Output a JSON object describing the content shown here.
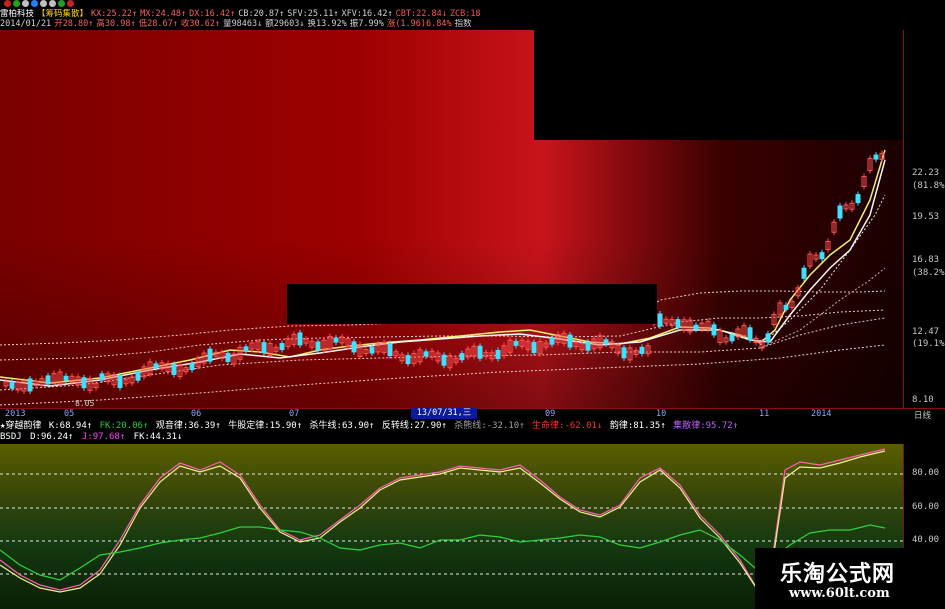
{
  "header": {
    "line1": [
      {
        "text": "雷柏科技",
        "color": "#ffffff"
      },
      {
        "text": "【筹码集散】",
        "color": "#ffd200"
      },
      {
        "text": "KX:25.22↑",
        "color": "#ff6060"
      },
      {
        "text": "MX:24.48↑",
        "color": "#ff6060"
      },
      {
        "text": "DX:16.42↑",
        "color": "#ff6060"
      },
      {
        "text": "CB:20.87↑",
        "color": "#d0d0d0"
      },
      {
        "text": "SFV:25.11↑",
        "color": "#d0d0d0"
      },
      {
        "text": "XFV:16.42↑",
        "color": "#d0d0d0"
      },
      {
        "text": "CBT:22.84↓",
        "color": "#ff5050"
      },
      {
        "text": "ZCB:18",
        "color": "#ff5050"
      }
    ],
    "line2": [
      {
        "text": "2014/01/21",
        "color": "#d0d0d0"
      },
      {
        "text": "开28.80↑",
        "color": "#ff6060"
      },
      {
        "text": "高30.98↑",
        "color": "#ff6060"
      },
      {
        "text": "低28.67↑",
        "color": "#ff6060"
      },
      {
        "text": "收30.62↑",
        "color": "#ff6060"
      },
      {
        "text": "量98463↓",
        "color": "#d0d0d0"
      },
      {
        "text": "额29603↓",
        "color": "#d0d0d0"
      },
      {
        "text": "换13.92%",
        "color": "#d0d0d0"
      },
      {
        "text": "振7.99%",
        "color": "#d0d0d0"
      },
      {
        "text": "涨(1.96)6.84%",
        "color": "#ff6060"
      },
      {
        "text": "指数",
        "color": "#d0d0d0"
      }
    ]
  },
  "price_axis": {
    "labels": [
      "22.23",
      "(81.8%)",
      "19.53",
      "16.83",
      "(38.2%)",
      "12.47",
      "(19.1%)",
      "8.10"
    ]
  },
  "date_axis": {
    "labels": [
      "2013",
      "05",
      "06",
      "07",
      "09",
      "10",
      "11",
      "2014"
    ],
    "cursor_label": "13/07/31,三",
    "period": "日线",
    "low_value": "8.05"
  },
  "indicator_line1": [
    {
      "text": "★穿越韵律",
      "color": "#ffffff"
    },
    {
      "text": "K:68.94↑",
      "color": "#ffffff"
    },
    {
      "text": "FK:20.06↑",
      "color": "#20c840"
    },
    {
      "text": "观音律:36.39↑",
      "color": "#ffffff"
    },
    {
      "text": "牛股定律:15.90↑",
      "color": "#ffffff"
    },
    {
      "text": "杀牛线:63.90↑",
      "color": "#ffffff"
    },
    {
      "text": "反转线:27.90↑",
      "color": "#ffffff"
    },
    {
      "text": "杀熊线:-32.10↑",
      "color": "#a0a0a0"
    },
    {
      "text": "生命律:-62.01↓",
      "color": "#ff3030"
    },
    {
      "text": "韵律:81.35↑",
      "color": "#ffffff"
    },
    {
      "text": "集散律:95.72↑",
      "color": "#c060ff"
    }
  ],
  "indicator_line2": [
    {
      "text": "BSDJ",
      "color": "#ffffff"
    },
    {
      "text": "D:96.24↑",
      "color": "#ffffff"
    },
    {
      "text": "J:97.68↑",
      "color": "#ff40ff"
    },
    {
      "text": "FK:44.31↓",
      "color": "#ffffff"
    }
  ],
  "osc_axis": {
    "labels": [
      "80.00",
      "60.00",
      "40.00"
    ]
  },
  "watermark": {
    "title": "乐淘公式网",
    "url": "www.60lt.com"
  }
}
